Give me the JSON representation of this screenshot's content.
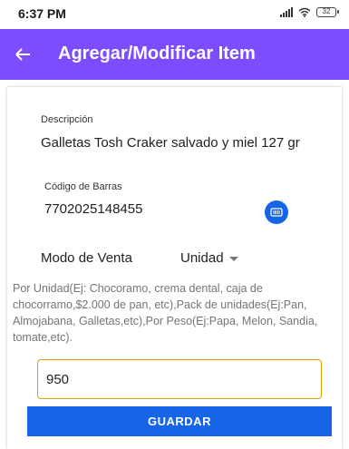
{
  "status_bar": {
    "time": "6:37 PM",
    "battery": "32"
  },
  "app_bar": {
    "title": "Agregar/Modificar Item",
    "color": "#7c4dff"
  },
  "description": {
    "label": "Descripción",
    "value": "Galletas Tosh Craker salvado y miel 127 gr"
  },
  "barcode": {
    "label": "Código de Barras",
    "value": "7702025148455",
    "icon": "barcode-icon"
  },
  "sale_mode": {
    "label": "Modo de Venta",
    "selected": "Unidad"
  },
  "help_text": "Por Unidad(Ej: Chocoramo, crema dental, caja de chocorramo,$2.000 de pan, etc),Pack de unidades(Ej:Pan, Almojabana, Galletas,etc),Por Peso(Ej:Papa, Melon, Sandia, tomate,etc).",
  "amount": {
    "value": "950"
  },
  "save_button": {
    "label": "GUARDAR",
    "color": "#1565e6"
  }
}
